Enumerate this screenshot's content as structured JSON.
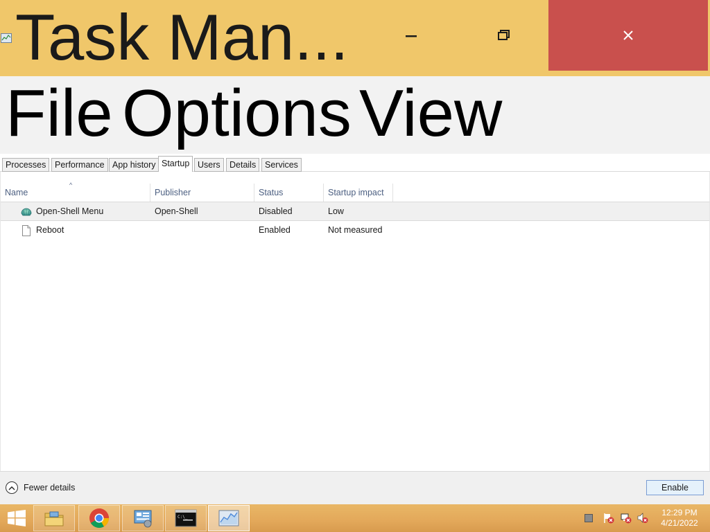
{
  "window": {
    "title": "Task Man...",
    "minimize_icon": "minimize-icon",
    "maximize_icon": "restore-icon",
    "close_icon": "close-icon",
    "titlebar_color": "#f0c76a",
    "close_color": "#c9504d"
  },
  "menu": {
    "items": [
      {
        "label": "File"
      },
      {
        "label": "Options"
      },
      {
        "label": "View"
      }
    ]
  },
  "tabs": [
    {
      "label": "Processes"
    },
    {
      "label": "Performance"
    },
    {
      "label": "App history"
    },
    {
      "label": "Startup",
      "active": true
    },
    {
      "label": "Users"
    },
    {
      "label": "Details"
    },
    {
      "label": "Services"
    }
  ],
  "table": {
    "columns": [
      {
        "label": "Name"
      },
      {
        "label": "Publisher"
      },
      {
        "label": "Status"
      },
      {
        "label": "Startup impact"
      }
    ],
    "rows": [
      {
        "name": "Open-Shell Menu",
        "publisher": "Open-Shell",
        "status": "Disabled",
        "impact": "Low",
        "icon": "open-shell-icon",
        "selected": true
      },
      {
        "name": "Reboot",
        "publisher": "",
        "status": "Enabled",
        "impact": "Not measured",
        "icon": "file-icon",
        "selected": false
      }
    ]
  },
  "footer": {
    "fewer_details": "Fewer details",
    "enable_button": "Enable"
  },
  "taskbar": {
    "apps": [
      {
        "name": "file-explorer-icon"
      },
      {
        "name": "chrome-icon"
      },
      {
        "name": "control-panel-icon"
      },
      {
        "name": "command-prompt-icon"
      },
      {
        "name": "task-manager-icon",
        "active": true
      }
    ],
    "clock_time": "12:29 PM",
    "clock_date": "4/21/2022"
  }
}
